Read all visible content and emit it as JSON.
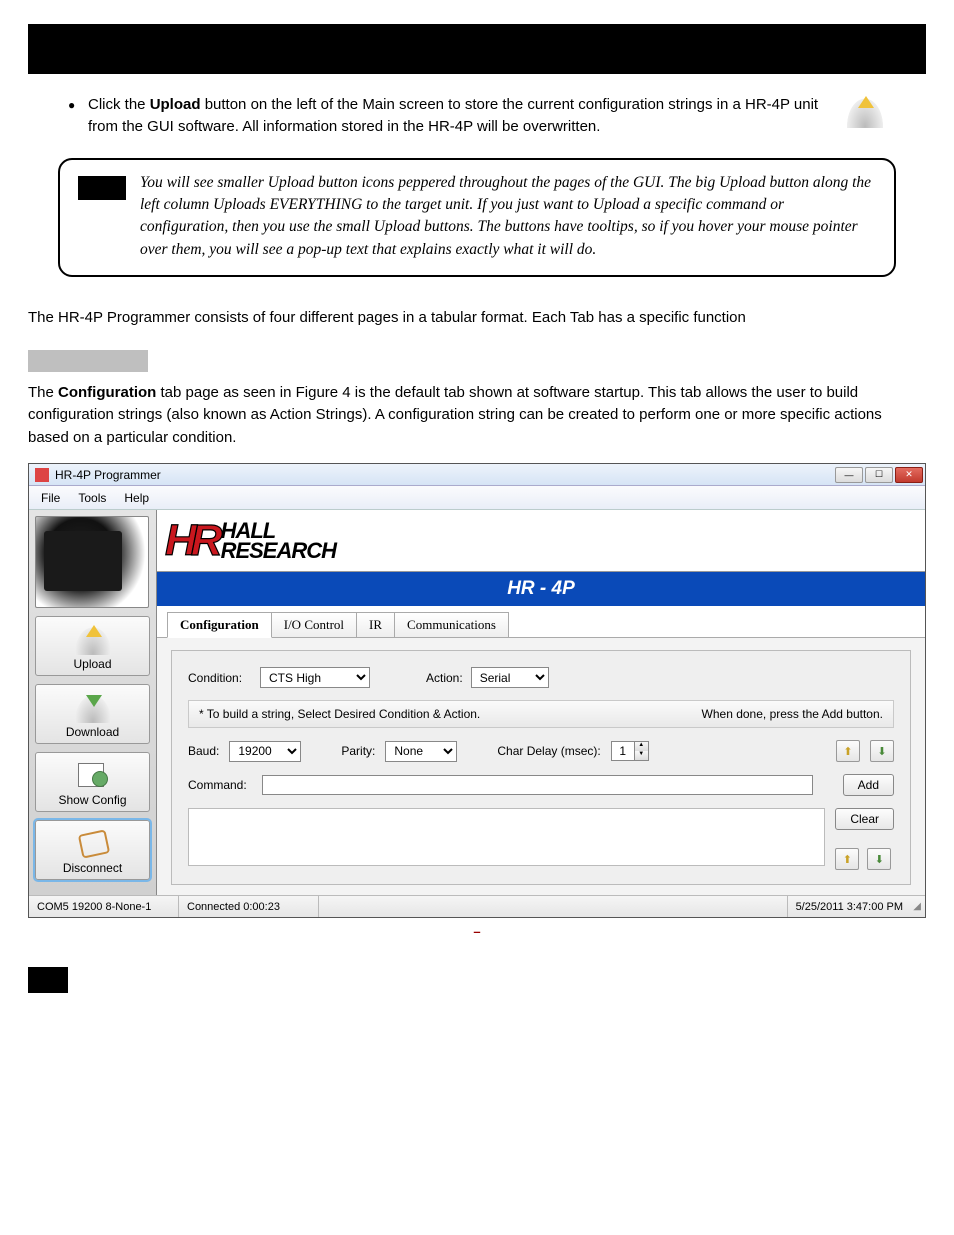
{
  "bullet": {
    "pre": "Click the ",
    "bold": "Upload",
    "post": " button on the left of the Main screen to store the current configuration strings in a HR-4P unit from the GUI software. All information stored in the HR-4P will be overwritten."
  },
  "note": "You will see smaller Upload button icons peppered throughout the pages of the GUI. The big Upload button along the left column Uploads EVERYTHING to the target unit. If you just want to Upload a specific command or configuration, then you use the small Upload buttons. The buttons have tooltips, so if you hover your mouse pointer over them, you will see a pop-up text that explains exactly what it will do.",
  "para1": "The HR-4P Programmer consists of four different pages in a tabular format. Each Tab has a specific function",
  "para2": {
    "pre": "The ",
    "bold": "Configuration",
    "post": " tab page as seen in Figure 4 is the default tab shown at software startup. This tab allows the user to build configuration strings (also known as Action Strings). A configuration string can be created to perform one or more specific actions based on a particular condition."
  },
  "figcap": "–",
  "app": {
    "title": "HR-4P Programmer",
    "menu": {
      "file": "File",
      "tools": "Tools",
      "help": "Help"
    },
    "logo": {
      "l1": "HALL",
      "l2": "RESEARCH"
    },
    "band": "HR - 4P",
    "tabs": {
      "t0": "Configuration",
      "t1": "I/O Control",
      "t2": "IR",
      "t3": "Communications"
    },
    "sidebar": {
      "upload": "Upload",
      "download": "Download",
      "showcfg": "Show Config",
      "disconnect": "Disconnect"
    },
    "labels": {
      "condition": "Condition:",
      "action": "Action:",
      "baud": "Baud:",
      "parity": "Parity:",
      "chardelay": "Char Delay (msec):",
      "command": "Command:"
    },
    "values": {
      "condition": "CTS High",
      "action": "Serial",
      "baud": "19200",
      "parity": "None",
      "chardelay": "1",
      "command": ""
    },
    "instr": {
      "left": "*   To build a string, Select Desired Condition & Action.",
      "right": "When done, press the Add button."
    },
    "buttons": {
      "add": "Add",
      "clear": "Clear"
    },
    "status": {
      "port": "COM5  19200 8-None-1",
      "conn": "Connected 0:00:23",
      "time": "5/25/2011 3:47:00 PM"
    }
  }
}
